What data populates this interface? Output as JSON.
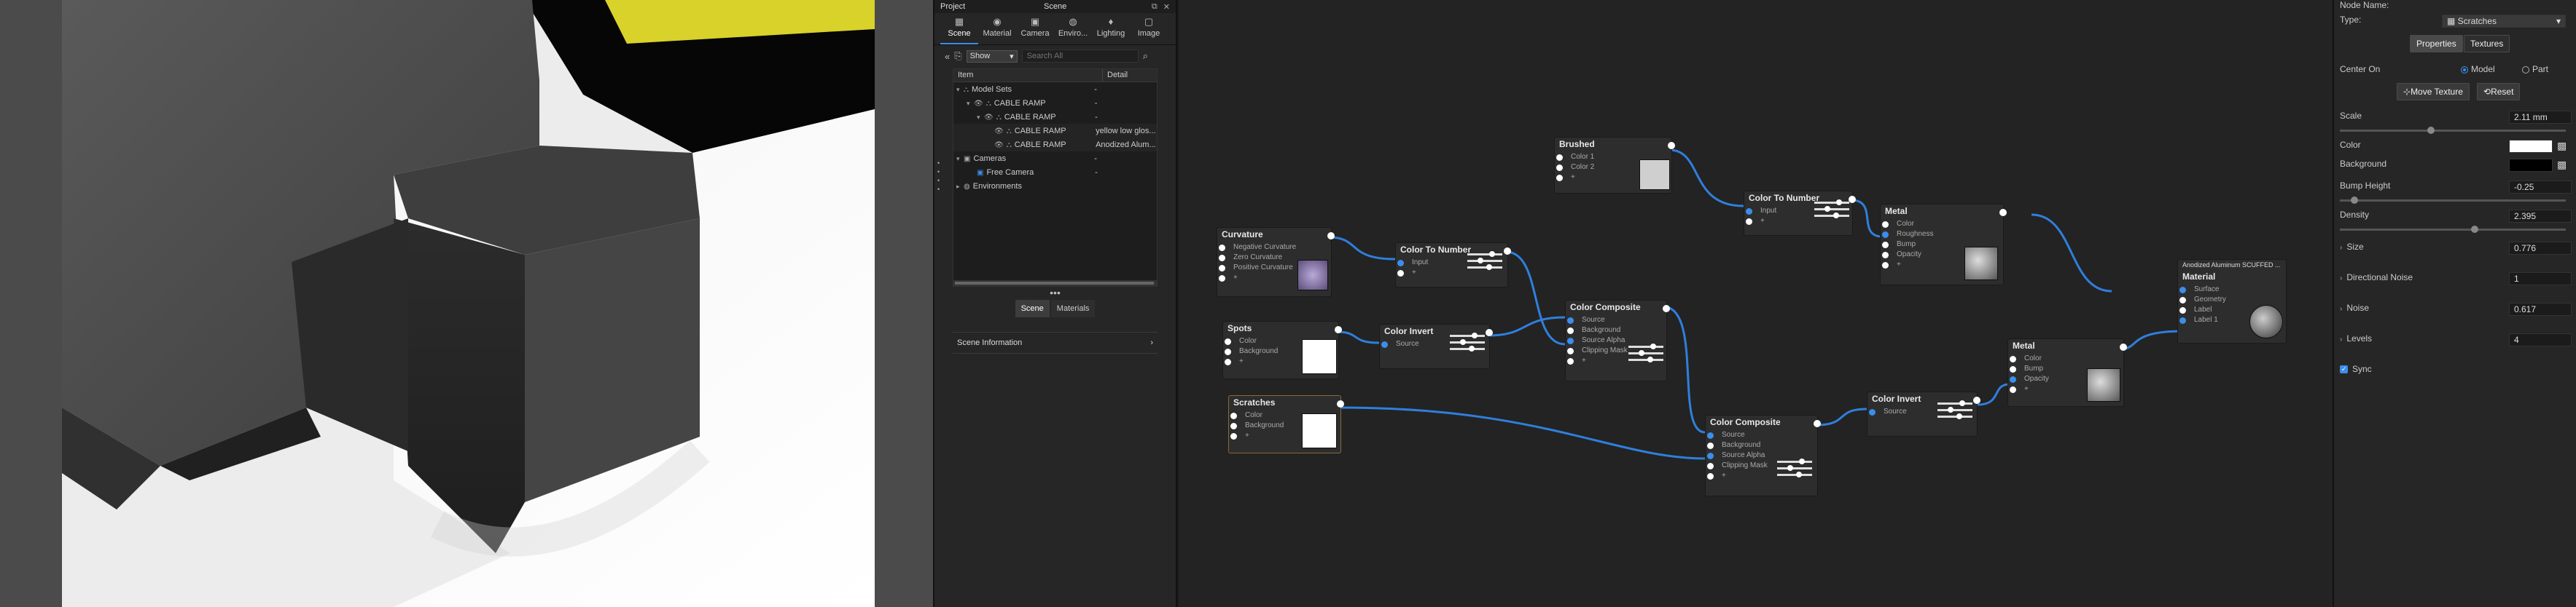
{
  "project": {
    "title": "Project",
    "scene_label": "Scene",
    "tabs": [
      {
        "label": "Scene",
        "icon": "scene-icon"
      },
      {
        "label": "Material",
        "icon": "material-icon"
      },
      {
        "label": "Camera",
        "icon": "camera-icon"
      },
      {
        "label": "Enviro...",
        "icon": "environment-icon"
      },
      {
        "label": "Lighting",
        "icon": "lighting-icon"
      },
      {
        "label": "Image",
        "icon": "image-icon"
      }
    ],
    "filter_value": "Show",
    "search_placeholder": "Search All",
    "columns": {
      "item": "Item",
      "detail": "Detail"
    },
    "tree": [
      {
        "name": "Model Sets",
        "detail": "-"
      },
      {
        "name": "CABLE RAMP",
        "detail": "-"
      },
      {
        "name": "CABLE RAMP",
        "detail": "-"
      },
      {
        "name": "CABLE RAMP",
        "detail": "yellow low glos..."
      },
      {
        "name": "CABLE RAMP",
        "detail": "Anodized Alum..."
      },
      {
        "name": "Cameras",
        "detail": "-"
      },
      {
        "name": "Free Camera",
        "detail": "-"
      },
      {
        "name": "Environments",
        "detail": ""
      }
    ],
    "bottom_tabs": [
      "Scene",
      "Materials"
    ],
    "scene_information": "Scene Information"
  },
  "graph": {
    "nodes": {
      "brushed": {
        "title": "Brushed",
        "ports": [
          "Color 1",
          "Color 2",
          "+"
        ]
      },
      "ctn1": {
        "title": "Color To Number",
        "ports": [
          "Input",
          "+"
        ]
      },
      "metal1": {
        "title": "Metal",
        "ports": [
          "Color",
          "Roughness",
          "Bump",
          "Opacity",
          "+"
        ]
      },
      "curvature": {
        "title": "Curvature",
        "ports": [
          "Negative Curvature",
          "Zero Curvature",
          "Positive Curvature",
          "+"
        ]
      },
      "ctn2": {
        "title": "Color To Number",
        "ports": [
          "Input",
          "+"
        ]
      },
      "comp1": {
        "title": "Color Composite",
        "ports": [
          "Source",
          "Background",
          "Source Alpha",
          "Clipping Mask",
          "+"
        ]
      },
      "spots": {
        "title": "Spots",
        "ports": [
          "Color",
          "Background",
          "+"
        ]
      },
      "invert1": {
        "title": "Color Invert",
        "ports": [
          "Source"
        ]
      },
      "material": {
        "header": "Anodized Aluminum SCUFFED ...",
        "title": "Material",
        "ports": [
          "Surface",
          "Geometry",
          "Label",
          "Label 1"
        ]
      },
      "metal2": {
        "title": "Metal",
        "ports": [
          "Color",
          "Bump",
          "Opacity",
          "+"
        ]
      },
      "scratches": {
        "title": "Scratches",
        "ports": [
          "Color",
          "Background",
          "+"
        ]
      },
      "invert2": {
        "title": "Color Invert",
        "ports": [
          "Source"
        ]
      },
      "comp2": {
        "title": "Color Composite",
        "ports": [
          "Source",
          "Background",
          "Source Alpha",
          "Clipping Mask",
          "+"
        ]
      }
    }
  },
  "props": {
    "node_name_label": "Node Name:",
    "type_label": "Type:",
    "type_value": "Scratches",
    "tab_properties": "Properties",
    "tab_textures": "Textures",
    "center_on_label": "Center On",
    "center_model": "Model",
    "center_part": "Part",
    "move_texture": "Move Texture",
    "reset": "Reset",
    "scale_label": "Scale",
    "scale_value": "2.11 mm",
    "scale_level": 0.4,
    "color_label": "Color",
    "color_value": "#ffffff",
    "background_label": "Background",
    "background_value": "#000000",
    "bump_label": "Bump Height",
    "bump_value": "-0.25",
    "bump_level": 0.05,
    "density_label": "Density",
    "density_value": "2.395",
    "density_level": 0.6,
    "size_label": "Size",
    "size_value": "0.776",
    "directional_label": "Directional Noise",
    "directional_value": "1",
    "noise_label": "Noise",
    "noise_value": "0.617",
    "levels_label": "Levels",
    "levels_value": "4",
    "sync_label": "Sync"
  }
}
